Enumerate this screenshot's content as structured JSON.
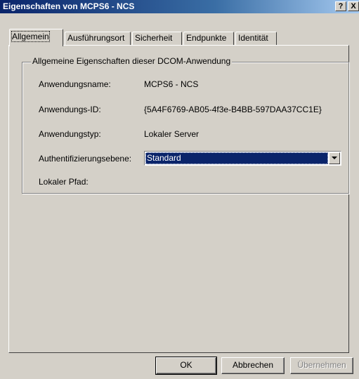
{
  "window": {
    "title": "Eigenschaften von MCPS6 - NCS",
    "help_button": "?",
    "close_button": "X"
  },
  "tabs": [
    {
      "label": "Allgemein",
      "active": true
    },
    {
      "label": "Ausführungsort",
      "active": false
    },
    {
      "label": "Sicherheit",
      "active": false
    },
    {
      "label": "Endpunkte",
      "active": false
    },
    {
      "label": "Identität",
      "active": false
    }
  ],
  "group": {
    "legend": "Allgemeine Eigenschaften dieser DCOM-Anwendung",
    "rows": [
      {
        "label": "Anwendungsname:",
        "value": "MCPS6 - NCS"
      },
      {
        "label": "Anwendungs-ID:",
        "value": "{5A4F6769-AB05-4f3e-B4BB-597DAA37CC1E}"
      },
      {
        "label": "Anwendungstyp:",
        "value": "Lokaler Server"
      },
      {
        "label": "Authentifizierungsebene:",
        "value": "Standard"
      },
      {
        "label": "Lokaler Pfad:",
        "value": ""
      }
    ]
  },
  "buttons": {
    "ok": "OK",
    "cancel": "Abbrechen",
    "apply": "Übernehmen"
  },
  "colors": {
    "title_bar": "#0a246a",
    "selection": "#0a246a",
    "face": "#d4d0c8"
  }
}
